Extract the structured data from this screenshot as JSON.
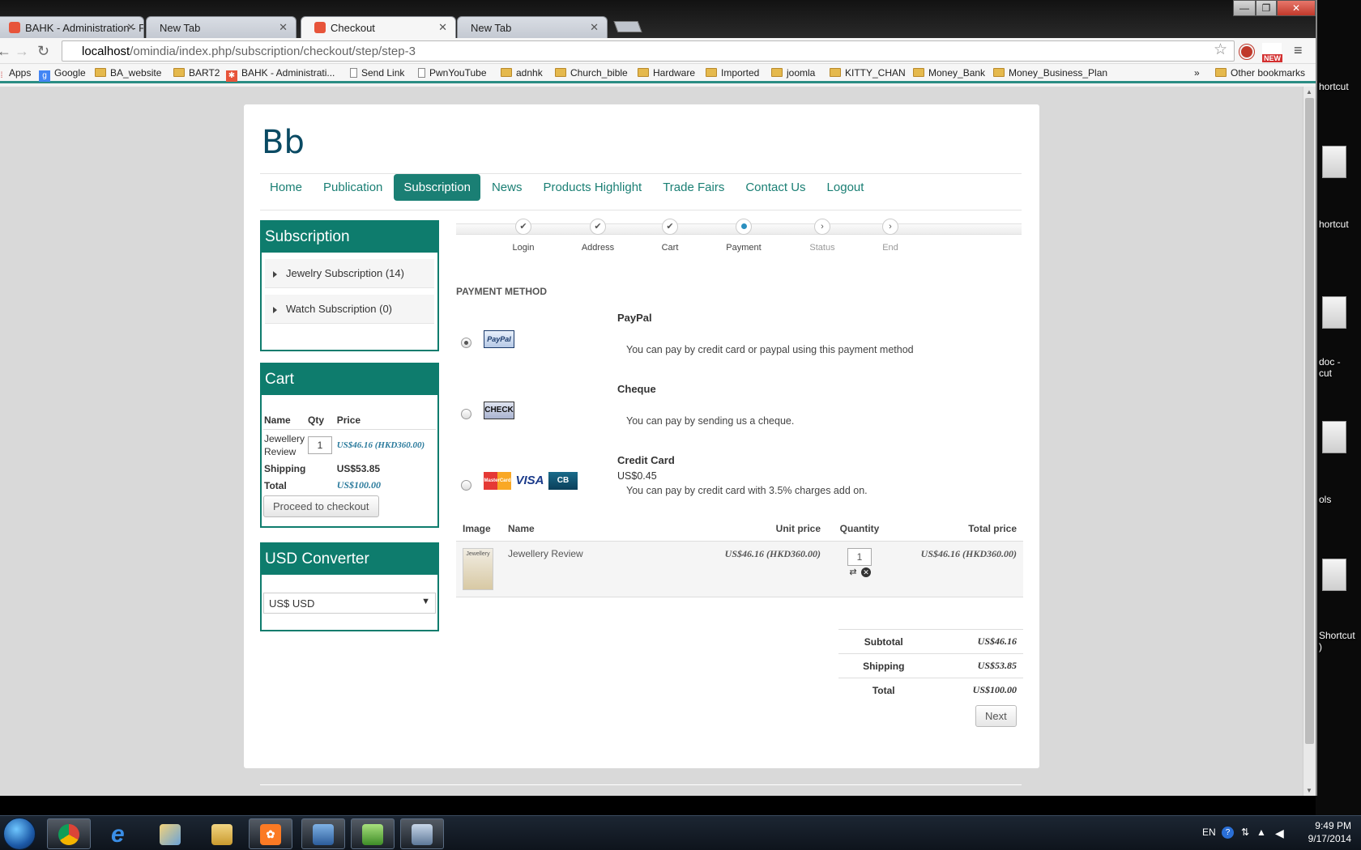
{
  "browser": {
    "tabs": [
      {
        "title": "BAHK - Administration - F",
        "active": false
      },
      {
        "title": "New Tab",
        "active": false
      },
      {
        "title": "Checkout",
        "active": true
      },
      {
        "title": "New Tab",
        "active": false
      }
    ],
    "url_host": "localhost",
    "url_path": "/omindia/index.php/subscription/checkout/step/step-3",
    "ext_badge": "NEW",
    "bookmarks": [
      {
        "label": "Apps",
        "type": "apps"
      },
      {
        "label": "Google",
        "type": "google"
      },
      {
        "label": "BA_website",
        "type": "folder"
      },
      {
        "label": "BART2",
        "type": "folder"
      },
      {
        "label": "BAHK - Administrati...",
        "type": "joomla"
      },
      {
        "label": "Send Link",
        "type": "page"
      },
      {
        "label": "PwnYouTube",
        "type": "page"
      },
      {
        "label": "adnhk",
        "type": "folder"
      },
      {
        "label": "Church_bible",
        "type": "folder"
      },
      {
        "label": "Hardware",
        "type": "folder"
      },
      {
        "label": "Imported",
        "type": "folder"
      },
      {
        "label": "joomla",
        "type": "folder"
      },
      {
        "label": "KITTY_CHAN",
        "type": "folder"
      },
      {
        "label": "Money_Bank",
        "type": "folder"
      },
      {
        "label": "Money_Business_Plan",
        "type": "folder"
      }
    ],
    "bookmarks_more": "»",
    "other_bookmarks": "Other bookmarks"
  },
  "site": {
    "logo": "Bb",
    "nav": [
      "Home",
      "Publication",
      "Subscription",
      "News",
      "Products Highlight",
      "Trade Fairs",
      "Contact Us",
      "Logout"
    ],
    "nav_active": "Subscription"
  },
  "sidebar": {
    "subscription": {
      "title": "Subscription",
      "items": [
        "Jewelry Subscription (14)",
        "Watch Subscription (0)"
      ]
    },
    "cart": {
      "title": "Cart",
      "headers": {
        "name": "Name",
        "qty": "Qty",
        "price": "Price"
      },
      "item": {
        "name": "Jewellery Review",
        "qty": "1",
        "price": "US$46.16 (HKD360.00)"
      },
      "shipping_label": "Shipping",
      "shipping_value": "US$53.85",
      "total_label": "Total",
      "total_value": "US$100.00",
      "checkout_button": "Proceed to checkout"
    },
    "converter": {
      "title": "USD Converter",
      "selected": "US$ USD"
    }
  },
  "steps": [
    {
      "label": "Login",
      "state": "done"
    },
    {
      "label": "Address",
      "state": "done"
    },
    {
      "label": "Cart",
      "state": "done"
    },
    {
      "label": "Payment",
      "state": "current"
    },
    {
      "label": "Status",
      "state": "future"
    },
    {
      "label": "End",
      "state": "future"
    }
  ],
  "payment": {
    "title": "PAYMENT METHOD",
    "methods": [
      {
        "name": "PayPal",
        "logo": "PayPal",
        "desc": "You can pay by credit card or paypal using this payment method",
        "selected": true
      },
      {
        "name": "Cheque",
        "logo": "CHECK",
        "desc": "You can pay by sending us a cheque.",
        "selected": false
      },
      {
        "name": "Credit Card",
        "fee": "US$0.45",
        "desc": "You can pay by credit card with  3.5% charges add on.",
        "selected": false,
        "logos": [
          "MasterCard",
          "VISA",
          "CB"
        ]
      }
    ]
  },
  "items_table": {
    "headers": {
      "image": "Image",
      "name": "Name",
      "unit_price": "Unit price",
      "quantity": "Quantity",
      "total_price": "Total price"
    },
    "rows": [
      {
        "thumb": "Jewellery",
        "name": "Jewellery Review",
        "unit_price": "US$46.16 (HKD360.00)",
        "quantity": "1",
        "total_price": "US$46.16 (HKD360.00)"
      }
    ]
  },
  "totals": {
    "subtotal_label": "Subtotal",
    "subtotal": "US$46.16",
    "shipping_label": "Shipping",
    "shipping": "US$53.85",
    "total_label": "Total",
    "total": "US$100.00"
  },
  "next_button": "Next",
  "desktop_icons": [
    "hortcut",
    "hortcut",
    "doc - \ncut",
    "ols",
    "Shortcut\n)"
  ],
  "taskbar": {
    "lang": "EN",
    "time": "9:49 PM",
    "date": "9/17/2014"
  },
  "colors": {
    "accent": "#1a7f74",
    "price": "#2a7a9c",
    "header_teal": "#0e7c6d"
  }
}
